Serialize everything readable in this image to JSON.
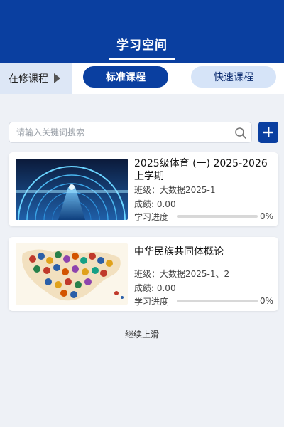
{
  "header": {
    "title": "学习空间"
  },
  "tabs": {
    "current_label": "在修课程",
    "standard_label": "标准课程",
    "quick_label": "快速课程"
  },
  "search": {
    "placeholder": "请输入关键词搜索",
    "value": ""
  },
  "courses": [
    {
      "title": "2025级体育 (一) 2025-2026上学期",
      "class_text": "班级：大数据2025-1",
      "score_text": "成绩: 0.00",
      "progress_label": "学习进度",
      "progress_value": 0,
      "progress_text": "0%",
      "thumbnail": "tunnel-bridge-image"
    },
    {
      "title": "中华民族共同体概论",
      "class_text": "班级：大数据2025-1、2",
      "score_text": "成绩: 0.00",
      "progress_label": "学习进度",
      "progress_value": 0,
      "progress_text": "0%",
      "thumbnail": "ethnic-groups-map-image"
    }
  ],
  "footer": {
    "hint": "继续上滑"
  },
  "colors": {
    "primary": "#0a3fa0",
    "tab_light": "#d6e4f8",
    "background": "#eef1f6"
  }
}
